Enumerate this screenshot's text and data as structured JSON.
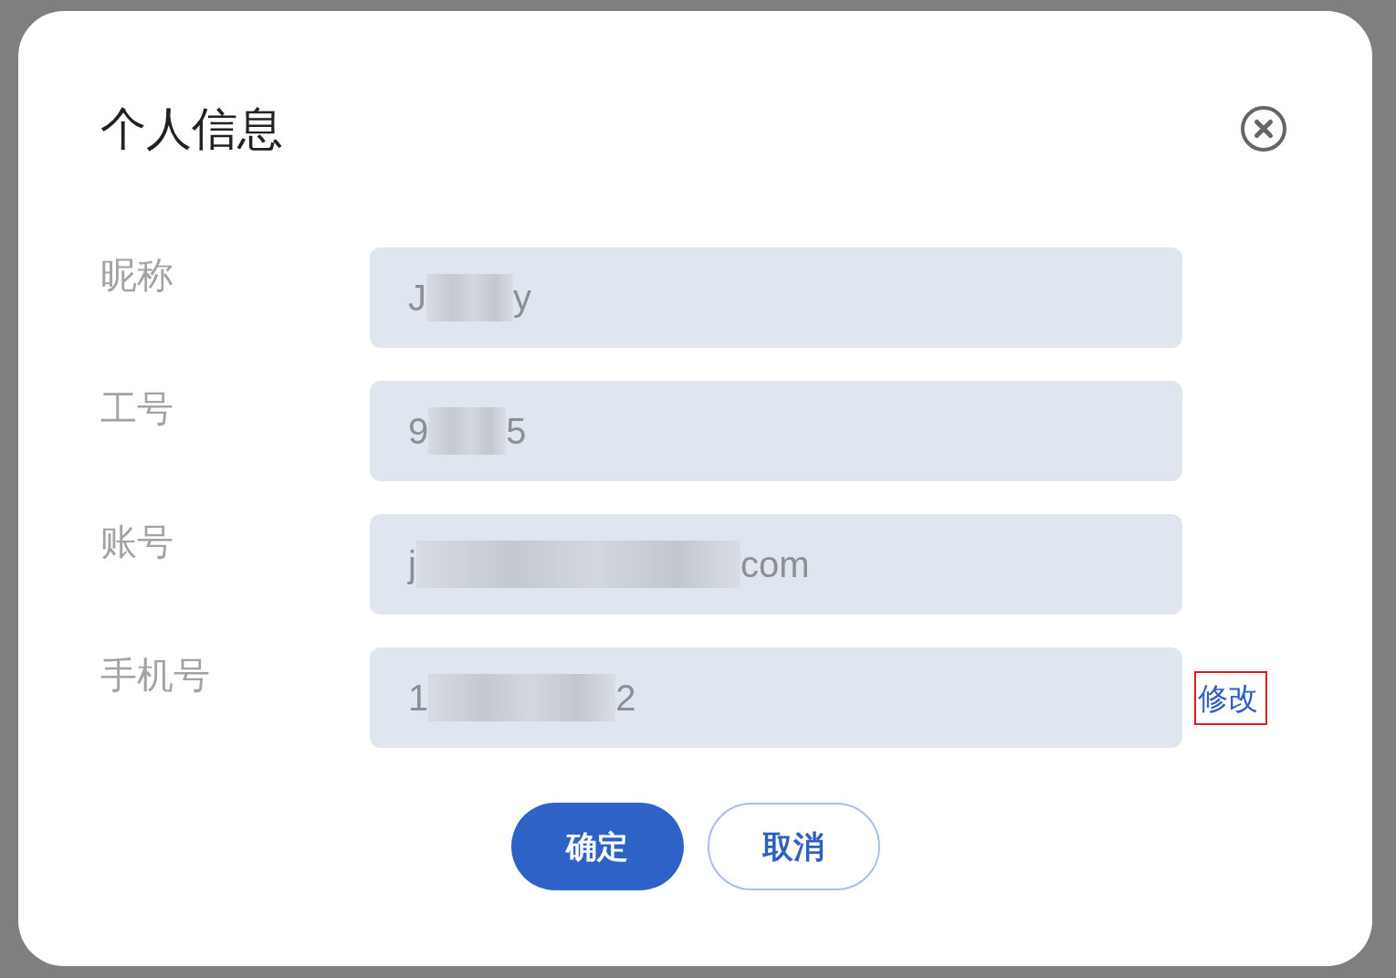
{
  "dialog": {
    "title": "个人信息",
    "fields": [
      {
        "label": "昵称",
        "value_start": "J",
        "value_end": "y",
        "redacted": true
      },
      {
        "label": "工号",
        "value_start": "9",
        "value_end": "5",
        "redacted": true
      },
      {
        "label": "账号",
        "value_start": "j",
        "value_end": "com",
        "redacted": true
      },
      {
        "label": "手机号",
        "value_start": "1",
        "value_end": "2",
        "redacted": true,
        "action": {
          "label": "修改",
          "highlighted": true
        }
      }
    ],
    "buttons": [
      {
        "label": "确定",
        "kind": "primary"
      },
      {
        "label": "取消",
        "kind": "secondary"
      }
    ]
  }
}
